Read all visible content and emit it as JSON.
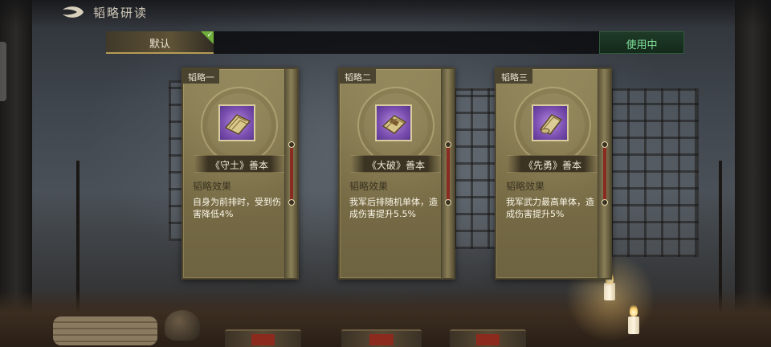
{
  "header": {
    "title": "韬略研读"
  },
  "tabs": {
    "default_label": "默认",
    "in_use_label": "使用中"
  },
  "cards": [
    {
      "slot_label": "韬略一",
      "item_name": "《守土》善本",
      "effect_heading": "韬略效果",
      "effect_text": "自身为前排时，受到伤害降低4%"
    },
    {
      "slot_label": "韬略二",
      "item_name": "《大破》善本",
      "effect_heading": "韬略效果",
      "effect_text": "我军后排随机单体，造成伤害提升5.5%"
    },
    {
      "slot_label": "韬略三",
      "item_name": "《先勇》善本",
      "effect_heading": "韬略效果",
      "effect_text": "我军武力最高单体，造成伤害提升5%"
    }
  ],
  "icons": {
    "back": "back-arrow-icon",
    "check": "check-icon",
    "book": "scroll-book-icon"
  },
  "colors": {
    "in_use_text": "#7fe09a",
    "check_badge": "#6fae3a",
    "item_rarity_purple": "#7a4fb0"
  }
}
